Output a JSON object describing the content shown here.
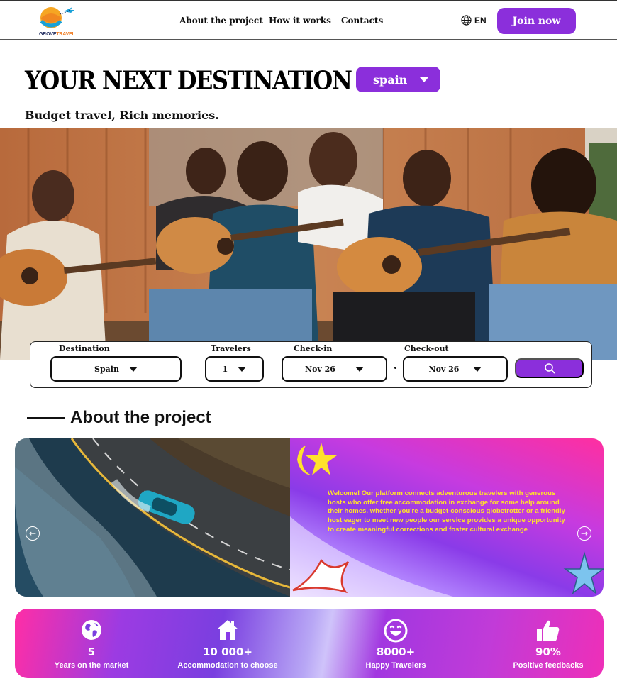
{
  "header": {
    "logo_text_a": "GROVE",
    "logo_text_b": "TRAVEL",
    "nav": [
      "About the project",
      "How it works",
      "Contacts"
    ],
    "language": "EN",
    "join_label": "Join now"
  },
  "hero": {
    "title": "YOUR NEXT DESTINATION IS",
    "destination": "spain",
    "tagline": "Budget travel, Rich memories."
  },
  "search": {
    "destination_label": "Destination",
    "destination_value": "Spain",
    "travelers_label": "Travelers",
    "travelers_value": "1",
    "checkin_label": "Check-in",
    "checkin_value": "Nov 26",
    "checkout_label": "Check-out",
    "checkout_value": "Nov 26"
  },
  "about": {
    "title": "About the project",
    "text": "Welcome! Our platform connects adventurous travelers with generous hosts who offer free accommodation in exchange for some help around their homes. whether you're a budget-conscious globetrotter or a friendly host eager to meet new people our service provides a unique opportunity to create meaningful corrections and foster cultural exchange"
  },
  "stats": [
    {
      "icon": "globe-icon",
      "value": "5",
      "label": "Years on the market"
    },
    {
      "icon": "house-icon",
      "value": "10 000+",
      "label": "Accommodation to choose"
    },
    {
      "icon": "smile-icon",
      "value": "8000+",
      "label": "Happy Travelers"
    },
    {
      "icon": "thumbs-up-icon",
      "value": "90%",
      "label": "Positive feedbacks"
    }
  ],
  "colors": {
    "accent": "#8b2fdb",
    "pink": "#ff2fa0",
    "text_yellow": "#ffe22b"
  }
}
